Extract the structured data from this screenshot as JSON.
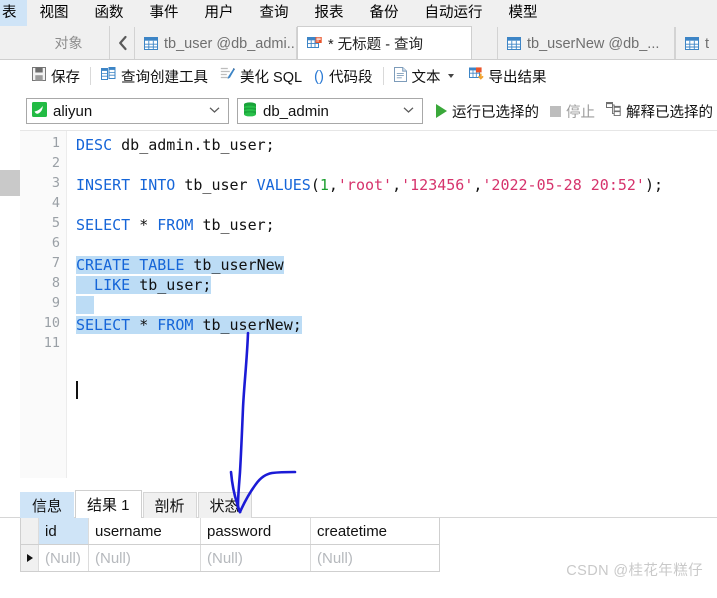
{
  "menubar": {
    "items": [
      {
        "label": "表",
        "active": true
      },
      {
        "label": "视图"
      },
      {
        "label": "函数"
      },
      {
        "label": "事件"
      },
      {
        "label": "用户"
      },
      {
        "label": "查询"
      },
      {
        "label": "报表"
      },
      {
        "label": "备份"
      },
      {
        "label": "自动运行"
      },
      {
        "label": "模型"
      }
    ]
  },
  "tabstrip": {
    "object_tab_label": "对象",
    "nav_back_icon": "chevron-left-icon",
    "tabs": [
      {
        "label": "tb_user @db_admi...",
        "icon": "table-grid-icon",
        "active": false
      },
      {
        "label": "* 无标题 - 查询",
        "icon": "query-icon",
        "active": true
      },
      {
        "label": "tb_userNew @db_...",
        "icon": "table-grid-icon",
        "active": false
      },
      {
        "label": "t",
        "icon": "table-grid-icon",
        "active": false
      }
    ]
  },
  "toolbar": {
    "save_label": "保存",
    "query_builder_label": "查询创建工具",
    "beautify_sql_label": "美化 SQL",
    "snippet_label": "代码段",
    "text_label": "文本",
    "export_result_label": "导出结果"
  },
  "toolbar2": {
    "connection": {
      "value": "aliyun",
      "icon": "mysql-connection-icon",
      "chevron": "chevron-down-icon"
    },
    "database": {
      "value": "db_admin",
      "icon": "database-cylinder-icon",
      "chevron": "chevron-down-icon"
    },
    "run_selected_label": "运行已选择的",
    "stop_label": "停止",
    "explain_selected_label": "解释已选择的"
  },
  "editor": {
    "line_numbers": [
      "1",
      "2",
      "3",
      "4",
      "5",
      "6",
      "7",
      "8",
      "9",
      "10",
      "11"
    ],
    "lines": [
      {
        "n": 1,
        "tokens": [
          {
            "t": "DESC ",
            "c": "k"
          },
          {
            "t": "db_admin.tb_user;",
            "c": "id"
          }
        ]
      },
      {
        "n": 2,
        "tokens": []
      },
      {
        "n": 3,
        "tokens": [
          {
            "t": "INSERT INTO ",
            "c": "k"
          },
          {
            "t": "tb_user ",
            "c": "id"
          },
          {
            "t": "VALUES",
            "c": "k"
          },
          {
            "t": "(",
            "c": "p"
          },
          {
            "t": "1",
            "c": "num"
          },
          {
            "t": ",",
            "c": "p"
          },
          {
            "t": "'root'",
            "c": "str"
          },
          {
            "t": ",",
            "c": "p"
          },
          {
            "t": "'123456'",
            "c": "str"
          },
          {
            "t": ",",
            "c": "p"
          },
          {
            "t": "'2022-05-28 20:52'",
            "c": "str"
          },
          {
            "t": ");",
            "c": "p"
          }
        ]
      },
      {
        "n": 4,
        "tokens": []
      },
      {
        "n": 5,
        "tokens": [
          {
            "t": "SELECT ",
            "c": "k"
          },
          {
            "t": "* ",
            "c": "p"
          },
          {
            "t": "FROM ",
            "c": "k"
          },
          {
            "t": "tb_user;",
            "c": "id"
          }
        ]
      },
      {
        "n": 6,
        "tokens": []
      },
      {
        "n": 7,
        "tokens": [
          {
            "t": "CREATE TABLE ",
            "c": "k"
          },
          {
            "t": "tb_userNew",
            "c": "id"
          }
        ],
        "selected": true
      },
      {
        "n": 8,
        "tokens": [
          {
            "t": "  LIKE ",
            "c": "k"
          },
          {
            "t": "tb_user;",
            "c": "id"
          }
        ],
        "selected": true
      },
      {
        "n": 9,
        "tokens": [
          {
            "t": "  ",
            "c": "p"
          }
        ],
        "selected": true
      },
      {
        "n": 10,
        "tokens": [
          {
            "t": "SELECT ",
            "c": "k"
          },
          {
            "t": "* ",
            "c": "p"
          },
          {
            "t": "FROM ",
            "c": "k"
          },
          {
            "t": "tb_userNew;",
            "c": "id"
          }
        ],
        "selected": true
      },
      {
        "n": 11,
        "tokens": []
      }
    ],
    "selected_text": "CREATE TABLE tb_userNew\n  LIKE tb_user;\n\nSELECT * FROM tb_userNew;"
  },
  "result": {
    "tabs": [
      {
        "label": "信息",
        "state": "hover"
      },
      {
        "label": "结果 1",
        "state": "active"
      },
      {
        "label": "剖析",
        "state": "normal"
      },
      {
        "label": "状态",
        "state": "normal"
      }
    ],
    "grid": {
      "columns": [
        "id",
        "username",
        "password",
        "createtime"
      ],
      "selected_column": "id",
      "rows": [
        {
          "marker": "current-row-marker",
          "cells": [
            "(Null)",
            "(Null)",
            "(Null)",
            "(Null)"
          ]
        }
      ]
    }
  },
  "annotation": {
    "type": "hand-drawn-arrow",
    "color": "#1b1bd6",
    "description": "blue freehand arrow from line 10 down to the 结果 1 tab"
  },
  "watermark": {
    "text": "CSDN @桂花年糕仔"
  },
  "colors": {
    "keyword": "#1565d8",
    "string": "#d6336c",
    "number": "#1a9e2e",
    "selection": "#bcdcf5",
    "accent": "#cfe4f7",
    "run_green": "#3aa83a"
  }
}
